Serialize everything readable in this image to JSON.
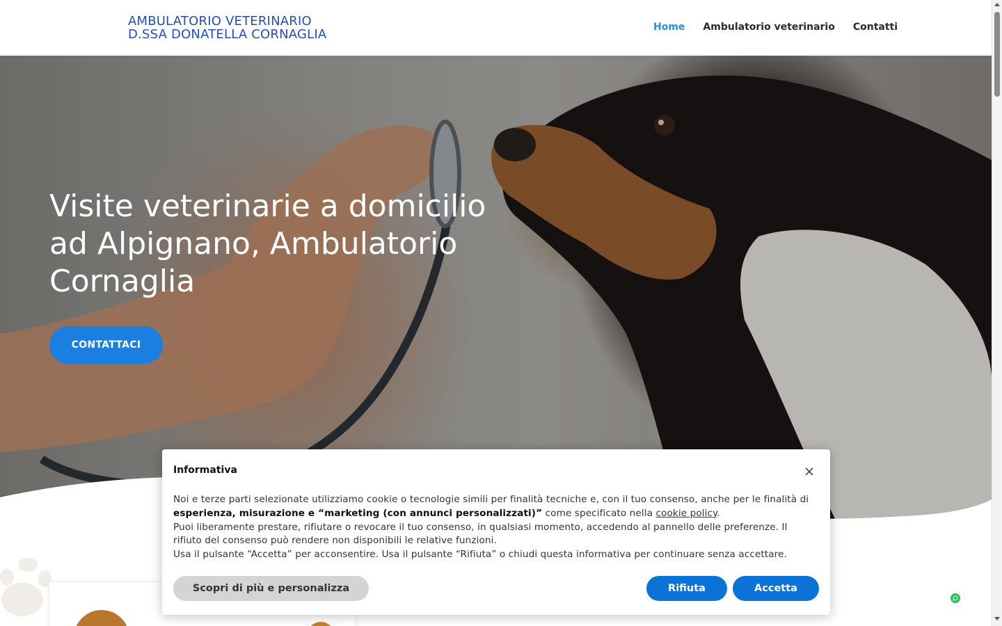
{
  "header": {
    "logo_line1": "AMBULATORIO VETERINARIO",
    "logo_line2": "D.SSA DONATELLA CORNAGLIA",
    "nav": [
      {
        "label": "Home",
        "active": true
      },
      {
        "label": "Ambulatorio veterinario",
        "active": false
      },
      {
        "label": "Contatti",
        "active": false
      }
    ]
  },
  "hero": {
    "title": "Visite veterinarie a domicilio ad Alpignano, Ambulatorio Cornaglia",
    "button_label": "CONTATTACI"
  },
  "cookie_banner": {
    "title": "Informativa",
    "text_part1": "Noi e terze parti selezionate utilizziamo cookie o tecnologie simili per finalità tecniche e, con il tuo consenso, anche per le finalità di ",
    "text_bold": "esperienza, misurazione e “marketing (con annunci personalizzati)”",
    "text_part2": " come specificato nella ",
    "link_label": "cookie policy",
    "text_part3": ".",
    "paragraph2": "Puoi liberamente prestare, rifiutare o revocare il tuo consenso, in qualsiasi momento, accedendo al pannello delle preferenze. Il rifiuto del consenso può rendere non disponibili le relative funzioni.",
    "paragraph3": "Usa il pulsante “Accetta” per acconsentire. Usa il pulsante “Rifiuta” o chiudi questa informativa per continuare senza accettare.",
    "btn_more": "Scopri di più e personalizza",
    "btn_reject": "Rifiuta",
    "btn_accept": "Accetta"
  },
  "colors": {
    "accent": "#1a7fe0",
    "logo": "#1f4fbf",
    "nav_active": "#2e8fd6",
    "whatsapp": "#25c35a"
  },
  "icons": {
    "close": "close-icon",
    "whatsapp": "whatsapp-icon",
    "paw": "paw-icon"
  }
}
